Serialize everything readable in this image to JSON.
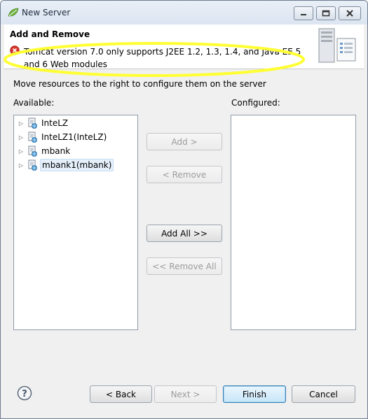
{
  "window": {
    "title": "New Server",
    "icon": "spring-leaf-icon"
  },
  "banner": {
    "title": "Add and Remove",
    "message": "Tomcat version 7.0 only supports J2EE 1.2, 1.3, 1.4, and Java EE 5 and 6 Web modules",
    "message_icon": "error-icon",
    "highlight_color": "#ffff33"
  },
  "instructions": "Move resources to the right to configure them on the server",
  "available": {
    "label": "Available:",
    "items": [
      {
        "label": "InteLZ"
      },
      {
        "label": "InteLZ1(InteLZ)"
      },
      {
        "label": "mbank"
      },
      {
        "label": "mbank1(mbank)"
      }
    ]
  },
  "configured": {
    "label": "Configured:",
    "items": []
  },
  "actions": {
    "add": "Add >",
    "remove": "< Remove",
    "add_all": "Add All >>",
    "remove_all": "<< Remove All"
  },
  "footer": {
    "back": "< Back",
    "next": "Next >",
    "finish": "Finish",
    "cancel": "Cancel"
  },
  "colors": {
    "accent": "#3c7fb1",
    "error": "#d9342b"
  }
}
